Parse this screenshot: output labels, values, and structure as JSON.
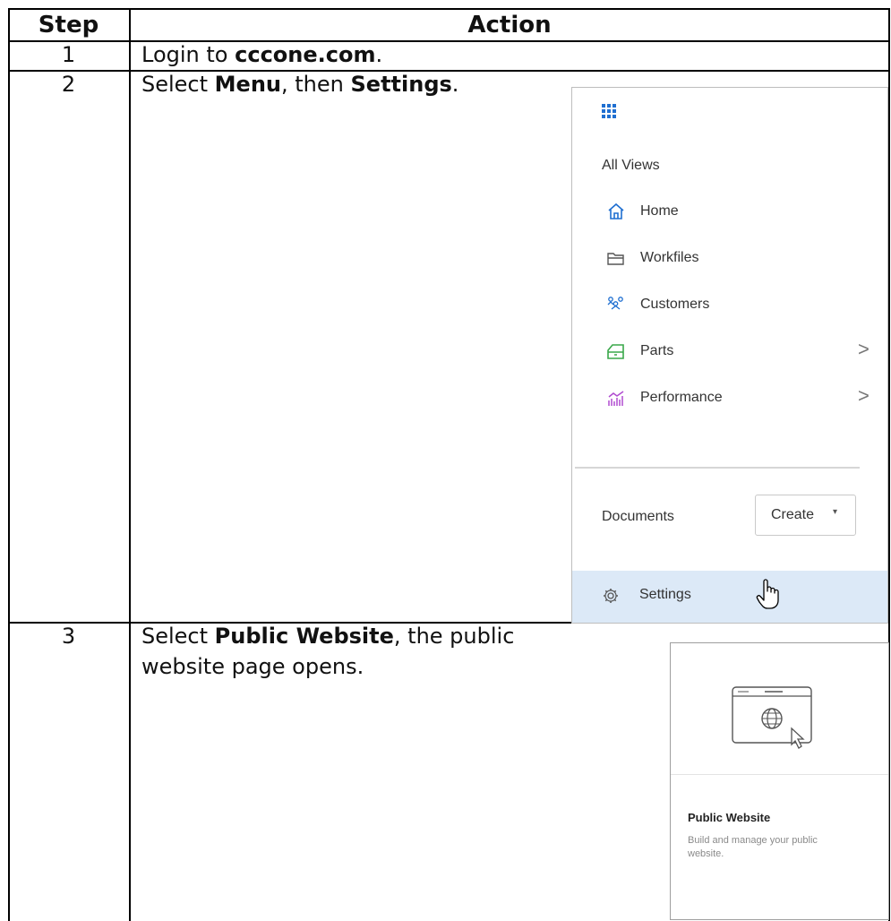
{
  "table": {
    "headers": {
      "step": "Step",
      "action": "Action"
    },
    "rows": [
      {
        "step": "1",
        "parts": [
          "Login to ",
          "cccone.com",
          "."
        ]
      },
      {
        "step": "2",
        "parts": [
          "Select ",
          "Menu",
          ", then ",
          "Settings",
          "."
        ]
      },
      {
        "step": "3",
        "parts": [
          "Select ",
          "Public Website",
          ", the public",
          "website page opens."
        ]
      }
    ]
  },
  "menu": {
    "section_label": "All Views",
    "items": [
      {
        "label": "Home",
        "icon": "home-icon",
        "color": "#1f6fd1"
      },
      {
        "label": "Workfiles",
        "icon": "folder-icon",
        "color": "#555555"
      },
      {
        "label": "Customers",
        "icon": "customers-icon",
        "color": "#1f6fd1"
      },
      {
        "label": "Parts",
        "icon": "parts-icon",
        "color": "#3aa84a",
        "chevron": ">"
      },
      {
        "label": "Performance",
        "icon": "performance-icon",
        "color": "#b04bd0",
        "chevron": ">"
      }
    ],
    "documents_label": "Documents",
    "create_label": "Create",
    "create_caret": "▾",
    "settings_label": "Settings"
  },
  "card": {
    "title": "Public Website",
    "description": "Build and manage your public website."
  }
}
